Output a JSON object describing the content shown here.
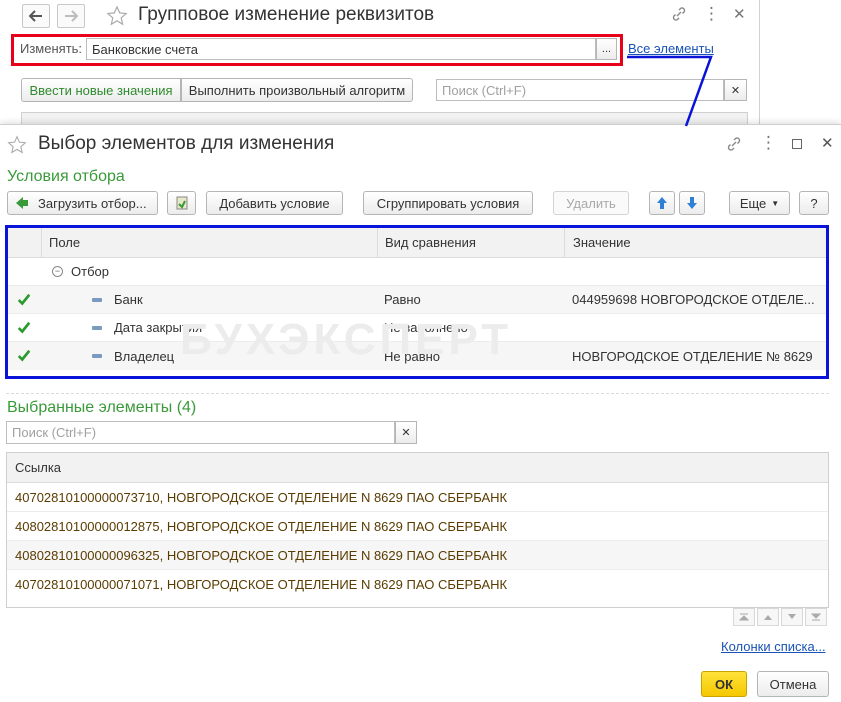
{
  "back_window": {
    "title": "Групповое изменение реквизитов",
    "change_label": "Изменять:",
    "change_value": "Банковские счета",
    "all_elements_link": "Все элементы",
    "tab_new_values": "Ввести новые значения",
    "tab_algorithm": "Выполнить произвольный алгоритм",
    "search_placeholder": "Поиск (Ctrl+F)"
  },
  "dialog": {
    "title": "Выбор элементов для изменения",
    "filter_section_title": "Условия отбора",
    "toolbar": {
      "load_filter": "Загрузить отбор...",
      "add_condition": "Добавить условие",
      "group_conditions": "Сгруппировать условия",
      "delete": "Удалить",
      "more": "Еще",
      "help": "?"
    },
    "filter_grid": {
      "columns": [
        "Поле",
        "Вид сравнения",
        "Значение"
      ],
      "group_label": "Отбор",
      "rows": [
        {
          "field": "Банк",
          "comparison": "Равно",
          "value": "044959698 НОВГОРОДСКОЕ ОТДЕЛЕ..."
        },
        {
          "field": "Дата закрытия",
          "comparison": "Не заполнено",
          "value": ""
        },
        {
          "field": "Владелец",
          "comparison": "Не равно",
          "value": "НОВГОРОДСКОЕ ОТДЕЛЕНИЕ № 8629"
        }
      ]
    },
    "watermark": "БУХЭКСПЕРТ",
    "selected_title": "Выбранные элементы (4)",
    "selected_search_placeholder": "Поиск (Ctrl+F)",
    "selected_list": {
      "column": "Ссылка",
      "rows": [
        "40702810100000073710, НОВГОРОДСКОЕ ОТДЕЛЕНИЕ N 8629 ПАО СБЕРБАНК",
        "40802810100000012875, НОВГОРОДСКОЕ ОТДЕЛЕНИЕ N 8629 ПАО СБЕРБАНК",
        "40802810100000096325, НОВГОРОДСКОЕ ОТДЕЛЕНИЕ N 8629 ПАО СБЕРБАНК",
        "40702810100000071071, НОВГОРОДСКОЕ ОТДЕЛЕНИЕ N 8629 ПАО СБЕРБАНК"
      ]
    },
    "columns_link": "Колонки списка...",
    "ok": "ОК",
    "cancel": "Отмена"
  },
  "colors": {
    "red_frame": "#e8001a",
    "blue_frame": "#0a13d8",
    "section_green": "#3a9a3a",
    "ok_yellow": "#f5c800",
    "link_blue": "#1a53b5"
  }
}
